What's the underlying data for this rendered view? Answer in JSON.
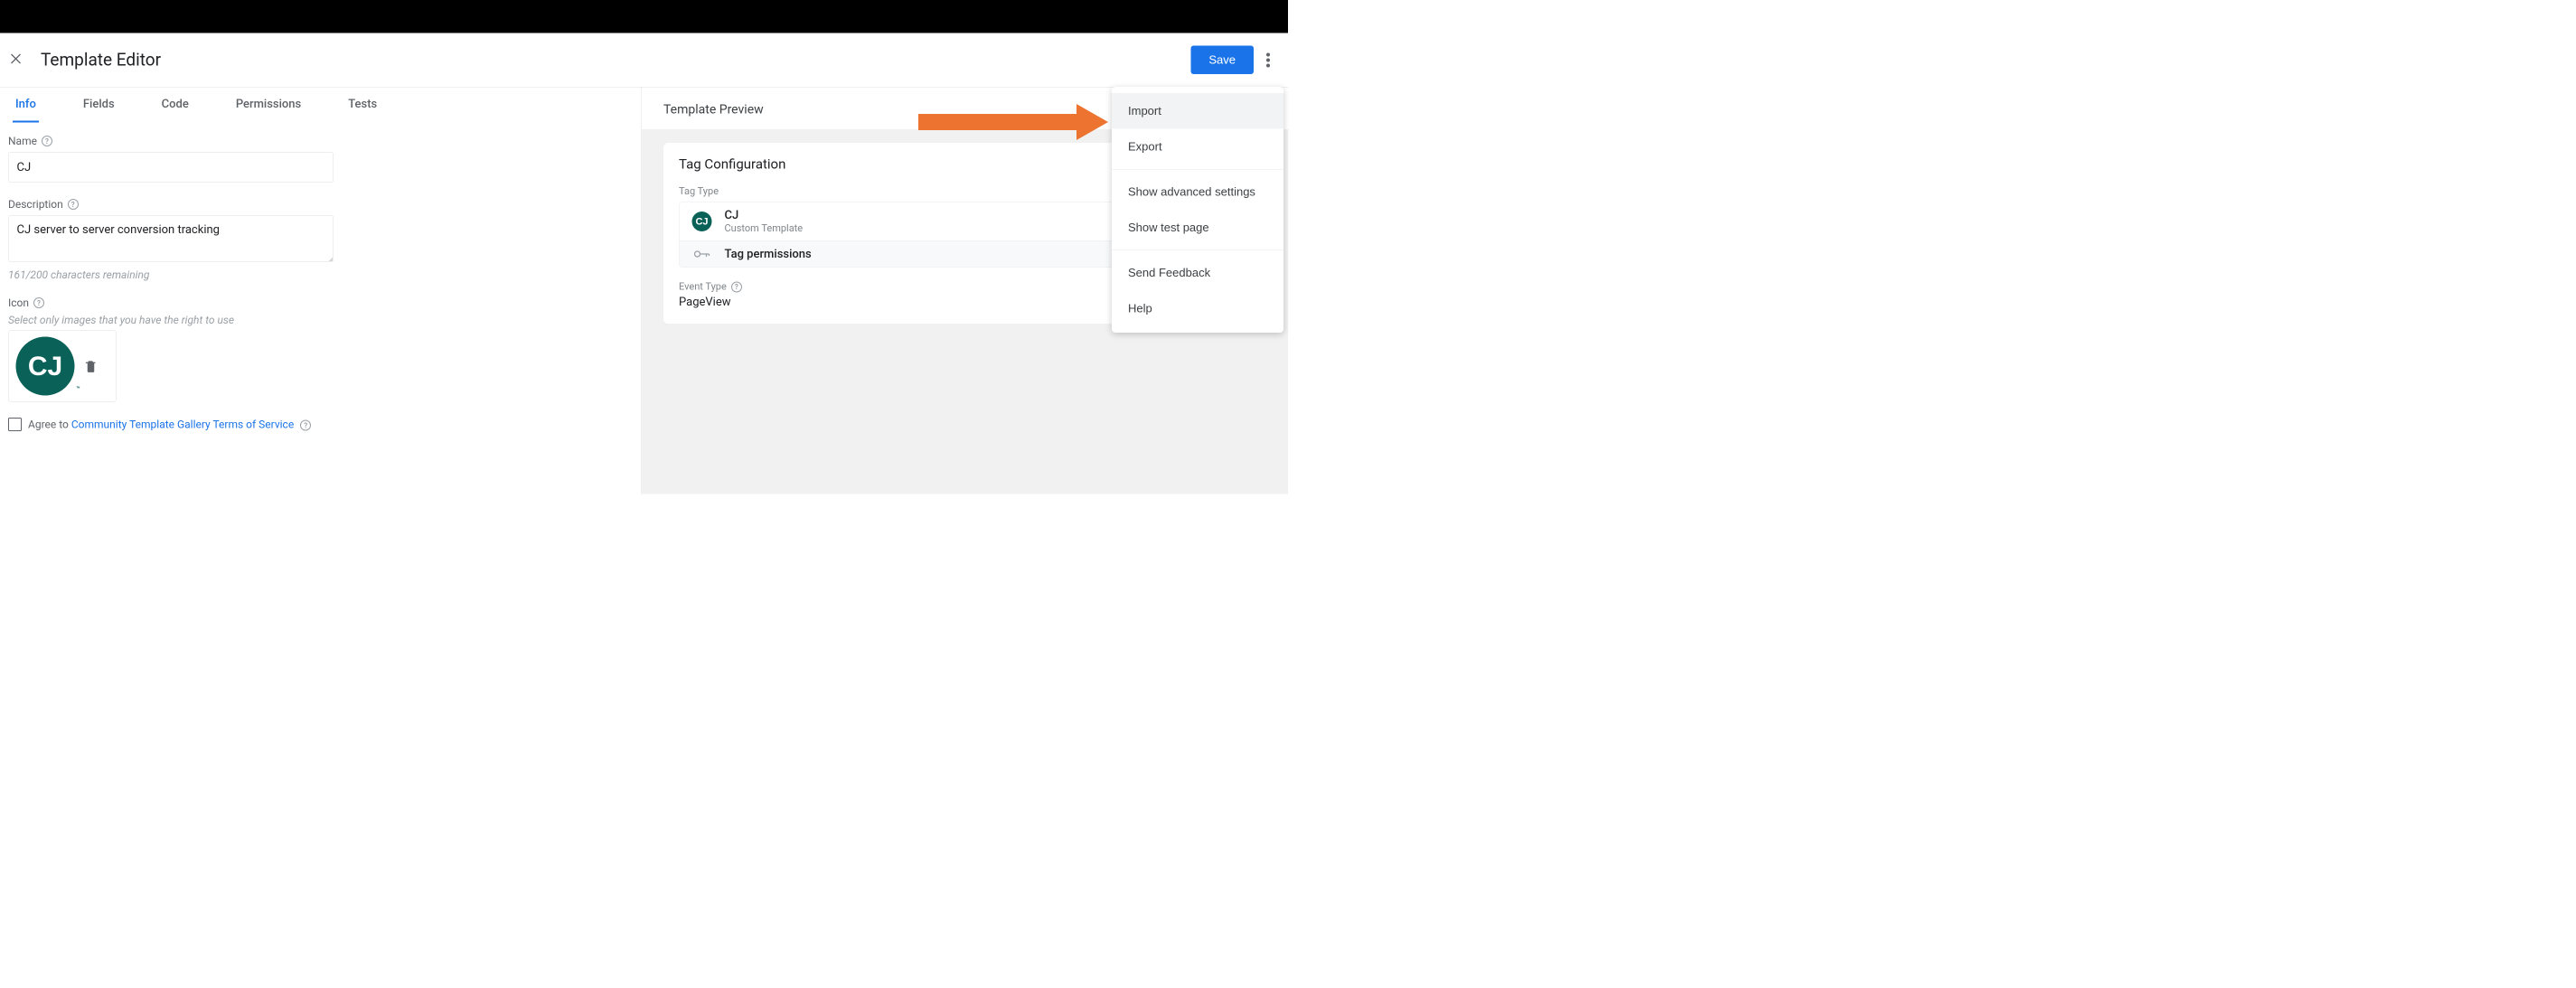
{
  "header": {
    "title": "Template Editor",
    "save_label": "Save"
  },
  "tabs": {
    "items": [
      {
        "label": "Info",
        "active": true
      },
      {
        "label": "Fields"
      },
      {
        "label": "Code"
      },
      {
        "label": "Permissions"
      },
      {
        "label": "Tests"
      }
    ]
  },
  "form": {
    "name_label": "Name",
    "name_value": "CJ",
    "description_label": "Description",
    "description_value": "CJ server to server conversion tracking",
    "description_helper": "161/200 characters remaining",
    "icon_label": "Icon",
    "icon_helper": "Select only images that you have the right to use",
    "agree_prefix": "Agree to ",
    "agree_link": "Community Template Gallery Terms of Service",
    "logo_initials": "CJ",
    "logo_tm": "™"
  },
  "preview": {
    "title": "Template Preview",
    "card_title": "Tag Configuration",
    "tag_type_label": "Tag Type",
    "template_name": "CJ",
    "template_sub": "Custom Template",
    "permissions_label": "Tag permissions",
    "event_type_label": "Event Type",
    "event_type_value": "PageView"
  },
  "menu": {
    "items": [
      {
        "label": "Import"
      },
      {
        "label": "Export"
      },
      {
        "label": "Show advanced settings"
      },
      {
        "label": "Show test page"
      },
      {
        "label": "Send Feedback"
      },
      {
        "label": "Help"
      }
    ]
  }
}
